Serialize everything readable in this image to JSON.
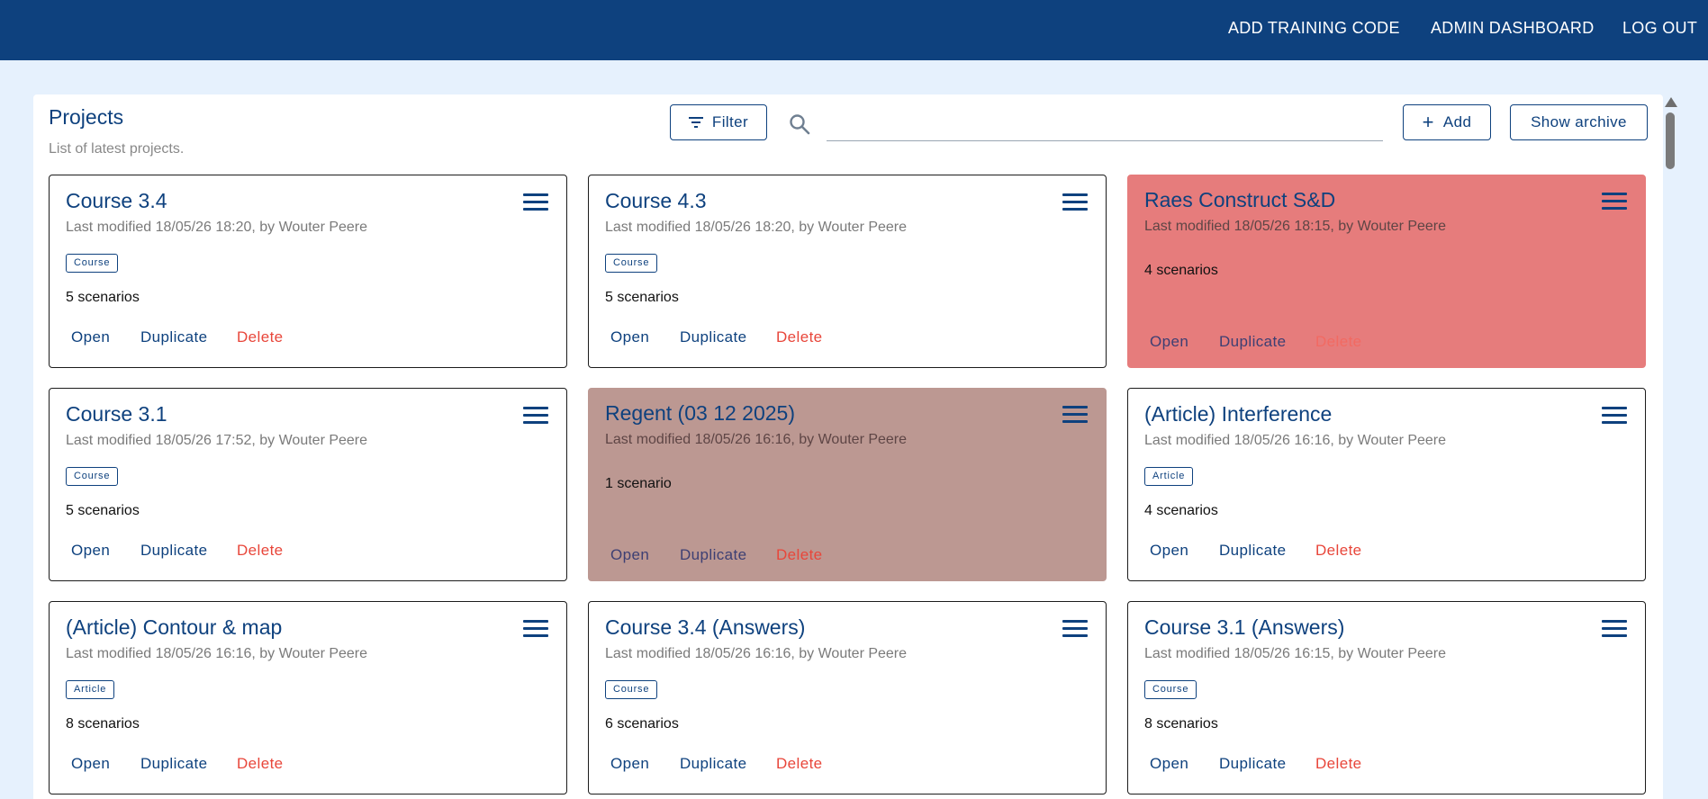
{
  "nav": {
    "add_training_code": "ADD TRAINING CODE",
    "admin_dashboard": "ADMIN DASHBOARD",
    "log_out": "LOG OUT"
  },
  "panel": {
    "title": "Projects",
    "subtitle": "List of latest projects."
  },
  "toolbar": {
    "filter_label": "Filter",
    "search_value": "",
    "add_label": "Add",
    "archive_label": "Show archive",
    "search_icon": "search-icon",
    "filter_icon": "filter-icon"
  },
  "actions": {
    "open": "Open",
    "duplicate": "Duplicate",
    "delete": "Delete"
  },
  "colors": {
    "primary": "#0e417e",
    "background": "#e6f1fd",
    "delete": "#e8463a",
    "card_red": "#e67c7c",
    "card_brown": "#bc9892"
  },
  "projects": [
    {
      "title": "Course 3.4",
      "meta": "Last modified 18/05/26 18:20, by Wouter Peere",
      "tag": "Course",
      "scenarios": "5 scenarios"
    },
    {
      "title": "Course 4.3",
      "meta": "Last modified 18/05/26 18:20, by Wouter Peere",
      "tag": "Course",
      "scenarios": "5 scenarios"
    },
    {
      "title": "Raes Construct S&D",
      "meta": "Last modified 18/05/26 18:15, by Wouter Peere",
      "tag": "",
      "scenarios": "4 scenarios"
    },
    {
      "title": "Course 3.1",
      "meta": "Last modified 18/05/26 17:52, by Wouter Peere",
      "tag": "Course",
      "scenarios": "5 scenarios"
    },
    {
      "title": "Regent (03 12 2025)",
      "meta": "Last modified 18/05/26 16:16, by Wouter Peere",
      "tag": "",
      "scenarios": "1 scenario"
    },
    {
      "title": "(Article) Interference",
      "meta": "Last modified 18/05/26 16:16, by Wouter Peere",
      "tag": "Article",
      "scenarios": "4 scenarios"
    },
    {
      "title": "(Article) Contour & map",
      "meta": "Last modified 18/05/26 16:16, by Wouter Peere",
      "tag": "Article",
      "scenarios": "8 scenarios"
    },
    {
      "title": "Course 3.4 (Answers)",
      "meta": "Last modified 18/05/26 16:16, by Wouter Peere",
      "tag": "Course",
      "scenarios": "6 scenarios"
    },
    {
      "title": "Course 3.1 (Answers)",
      "meta": "Last modified 18/05/26 16:15, by Wouter Peere",
      "tag": "Course",
      "scenarios": "8 scenarios"
    }
  ]
}
